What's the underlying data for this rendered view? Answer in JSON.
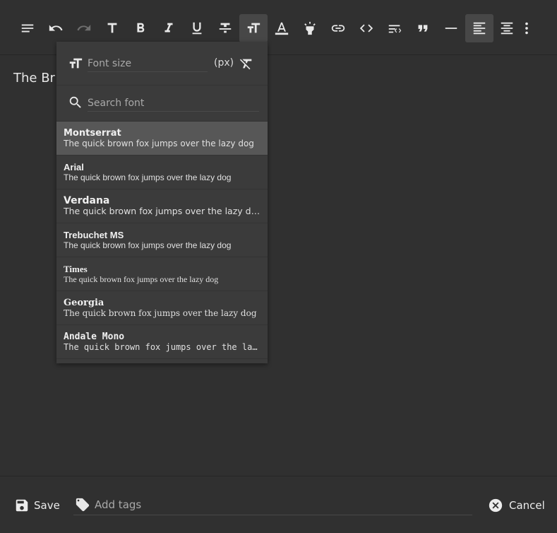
{
  "document": {
    "text": "The Br"
  },
  "toolbar": {
    "buttons": [
      {
        "name": "paragraph-format-icon"
      },
      {
        "name": "undo-icon"
      },
      {
        "name": "redo-icon"
      },
      {
        "name": "text-format-icon"
      },
      {
        "name": "bold-icon"
      },
      {
        "name": "italic-icon"
      },
      {
        "name": "underline-icon"
      },
      {
        "name": "strikethrough-icon"
      },
      {
        "name": "font-size-icon"
      },
      {
        "name": "text-color-icon"
      },
      {
        "name": "highlight-icon"
      },
      {
        "name": "link-icon"
      },
      {
        "name": "code-icon"
      },
      {
        "name": "code-block-icon"
      },
      {
        "name": "quote-icon"
      },
      {
        "name": "horizontal-rule-icon"
      },
      {
        "name": "align-left-icon"
      },
      {
        "name": "align-center-icon"
      },
      {
        "name": "more-icon"
      }
    ]
  },
  "font_dropdown": {
    "size_placeholder": "Font size",
    "size_unit": "(px)",
    "search_placeholder": "Search font",
    "fonts": [
      {
        "name": "Montserrat",
        "sample": "The quick brown fox jumps over the lazy dog",
        "selected": true
      },
      {
        "name": "Arial",
        "sample": "The quick brown fox jumps over the lazy dog"
      },
      {
        "name": "Verdana",
        "sample": "The quick brown fox jumps over the lazy dog"
      },
      {
        "name": "Trebuchet MS",
        "sample": "The quick brown fox jumps over the lazy dog"
      },
      {
        "name": "Times",
        "sample": "The quick brown fox jumps over the lazy dog"
      },
      {
        "name": "Georgia",
        "sample": "The quick brown fox jumps over the lazy dog"
      },
      {
        "name": "Andale Mono",
        "sample": "The quick brown fox jumps over the lazy dog"
      }
    ]
  },
  "footer": {
    "save_label": "Save",
    "tags_placeholder": "Add tags",
    "cancel_label": "Cancel"
  },
  "colors": {
    "background": "#303030",
    "dropdown": "#3b3b3b",
    "selected_item": "#575757",
    "active_button": "#474747"
  }
}
